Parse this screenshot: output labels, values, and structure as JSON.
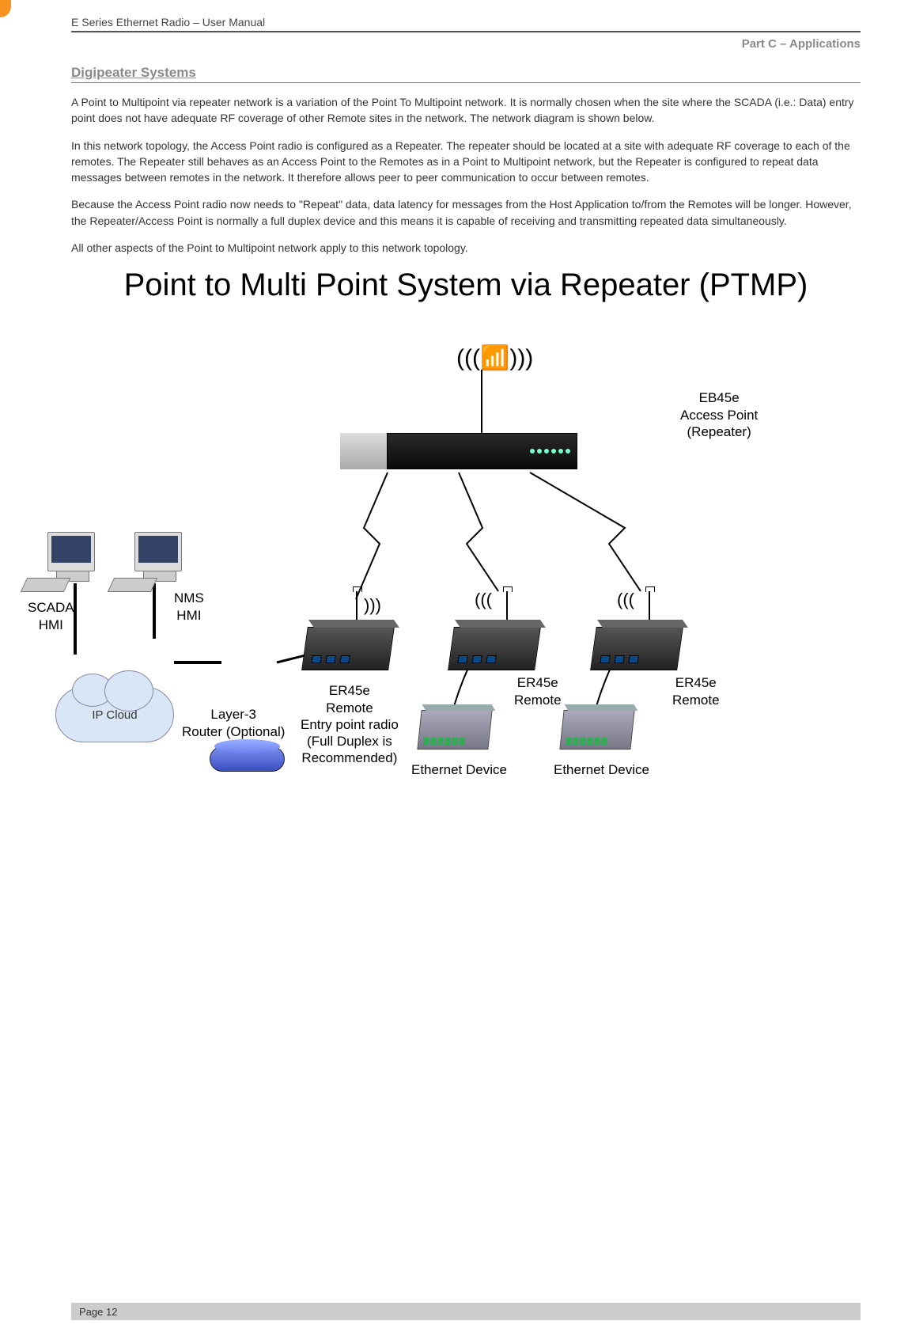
{
  "header": {
    "doc_title": "E Series Ethernet Radio – User Manual",
    "part_label": "Part C – Applications"
  },
  "section": {
    "heading": "Digipeater Systems",
    "p1": "A Point to Multipoint via repeater network is a variation of the Point To Multipoint network. It is normally chosen when the site where the SCADA (i.e.: Data) entry point does not have adequate RF coverage of other Remote sites in the network. The network diagram is shown below.",
    "p2": "In this network topology, the Access Point radio is configured as a Repeater. The repeater should be located at a site with adequate RF coverage to each of the remotes. The Repeater still behaves as an Access Point to the Remotes as in a Point to Multipoint network, but the Repeater is configured to repeat data messages between remotes in the network. It therefore allows peer to peer communication to occur between remotes.",
    "p3": "Because the Access Point radio now needs to \"Repeat\" data, data latency for messages from the Host Application to/from the Remotes will be longer. However, the Repeater/Access Point is normally a full duplex device and this means it is capable of receiving and transmitting repeated data simultaneously.",
    "p4": "All other aspects of the Point to Multipoint network apply to this network topology."
  },
  "diagram": {
    "title": "Point to Multi Point System via Repeater (PTMP)",
    "labels": {
      "access_point": "EB45e\nAccess Point\n(Repeater)",
      "scada": "SCADA\nHMI",
      "nms": "NMS\nHMI",
      "ip_cloud": "IP Cloud",
      "router": "Layer-3\nRouter (Optional)",
      "entry_radio": "ER45e\nRemote\nEntry point radio\n(Full Duplex is\nRecommended)",
      "remote1": "ER45e\nRemote",
      "remote2": "ER45e\nRemote",
      "eth_dev1": "Ethernet Device",
      "eth_dev2": "Ethernet Device"
    }
  },
  "footer": {
    "page": "Page 12"
  }
}
